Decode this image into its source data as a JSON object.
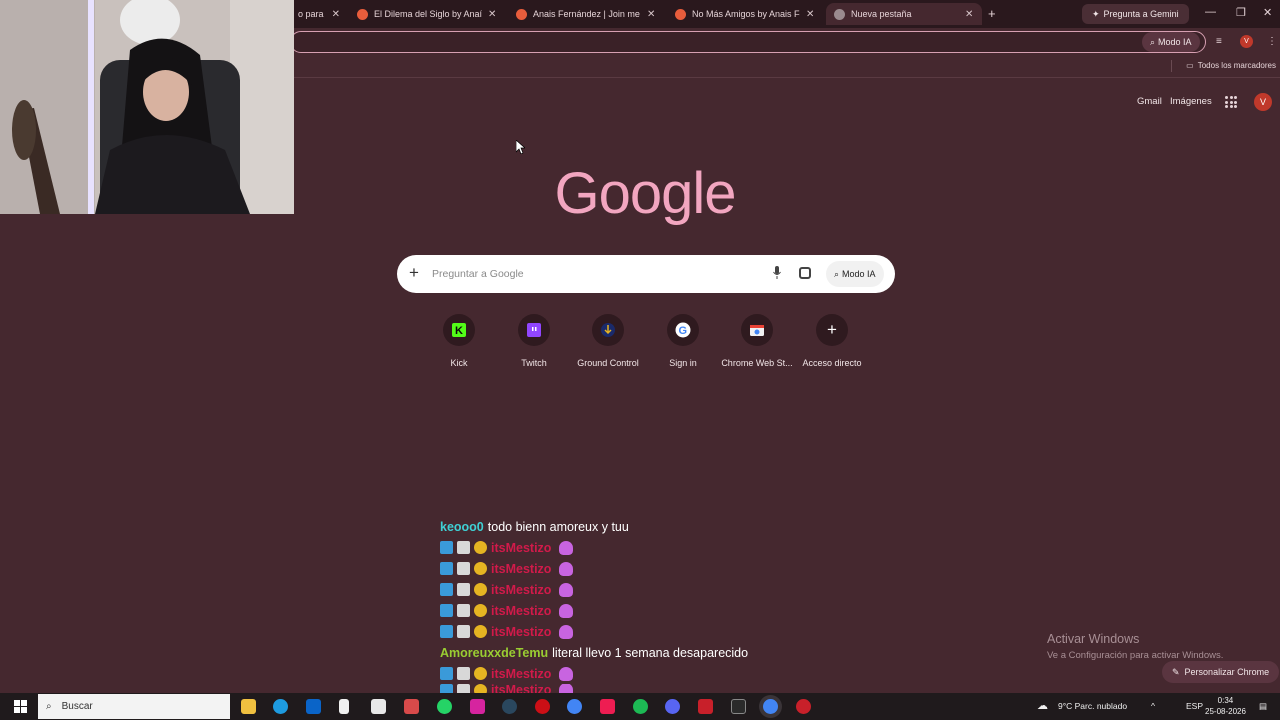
{
  "browser": {
    "tabs": [
      {
        "title": "o para t",
        "favicon": "#e0e0e0",
        "active": false
      },
      {
        "title": "El Dilema del Siglo by Anaís Fe",
        "favicon": "#e85d3c",
        "active": false
      },
      {
        "title": "Anais Fernández | Join me on S",
        "favicon": "#e85d3c",
        "active": false
      },
      {
        "title": "No Más Amigos by Anais Ferná",
        "favicon": "#e85d3c",
        "active": false
      },
      {
        "title": "Nueva pestaña",
        "favicon": "#9a8a8e",
        "active": true
      }
    ],
    "new_tab_symbol": "+",
    "gemini_label": "Pregunta a Gemini",
    "modo_ia_label": "Modo IA",
    "bookmarks_all_label": "Todos los marcadores",
    "profile_initial": "V"
  },
  "newtab": {
    "gmail_label": "Gmail",
    "images_label": "Imágenes",
    "avatar_initial": "V",
    "logo_text": "Google",
    "search_placeholder": "Preguntar a Google",
    "modo_ia_label": "Modo IA",
    "shortcuts": [
      {
        "label": "Kick",
        "icon": "kick-icon",
        "color": "#53fc18"
      },
      {
        "label": "Twitch",
        "icon": "twitch-icon",
        "color": "#9146ff"
      },
      {
        "label": "Ground Control",
        "icon": "ground-control-icon",
        "color": "#1a3a8a"
      },
      {
        "label": "Sign in",
        "icon": "google-icon",
        "color": "#ffffff"
      },
      {
        "label": "Chrome Web St...",
        "icon": "chrome-web-store-icon",
        "color": "#e94235"
      },
      {
        "label": "Acceso directo",
        "icon": "plus-icon",
        "color": "#ffffff"
      }
    ],
    "personalize_label": "Personalizar Chrome"
  },
  "chat": [
    {
      "user": "keooo0",
      "user_color": "#3fd0d4",
      "message": "todo bienn amoreux y tuu",
      "badges": false,
      "emote": false
    },
    {
      "user": "itsMestizo",
      "user_color": "#d11a4a",
      "message": "",
      "badges": true,
      "emote": true
    },
    {
      "user": "itsMestizo",
      "user_color": "#d11a4a",
      "message": "",
      "badges": true,
      "emote": true
    },
    {
      "user": "itsMestizo",
      "user_color": "#d11a4a",
      "message": "",
      "badges": true,
      "emote": true
    },
    {
      "user": "itsMestizo",
      "user_color": "#d11a4a",
      "message": "",
      "badges": true,
      "emote": true
    },
    {
      "user": "itsMestizo",
      "user_color": "#d11a4a",
      "message": "",
      "badges": true,
      "emote": true
    },
    {
      "user": "AmoreuxxdeTemu",
      "user_color": "#9acd32",
      "message": "literal llevo 1 semana desaparecido",
      "badges": false,
      "emote": false
    },
    {
      "user": "itsMestizo",
      "user_color": "#d11a4a",
      "message": "",
      "badges": true,
      "emote": true
    },
    {
      "user": "itsMestizo",
      "user_color": "#d11a4a",
      "message": "",
      "badges": true,
      "emote": true
    }
  ],
  "windows": {
    "activate_title": "Activar Windows",
    "activate_sub": "Ve a Configuración para activar Windows.",
    "search_label": "Buscar",
    "weather": "9°C  Parc. nublado",
    "language": "ESP",
    "time": "0:34",
    "date": "25-08-2026"
  }
}
